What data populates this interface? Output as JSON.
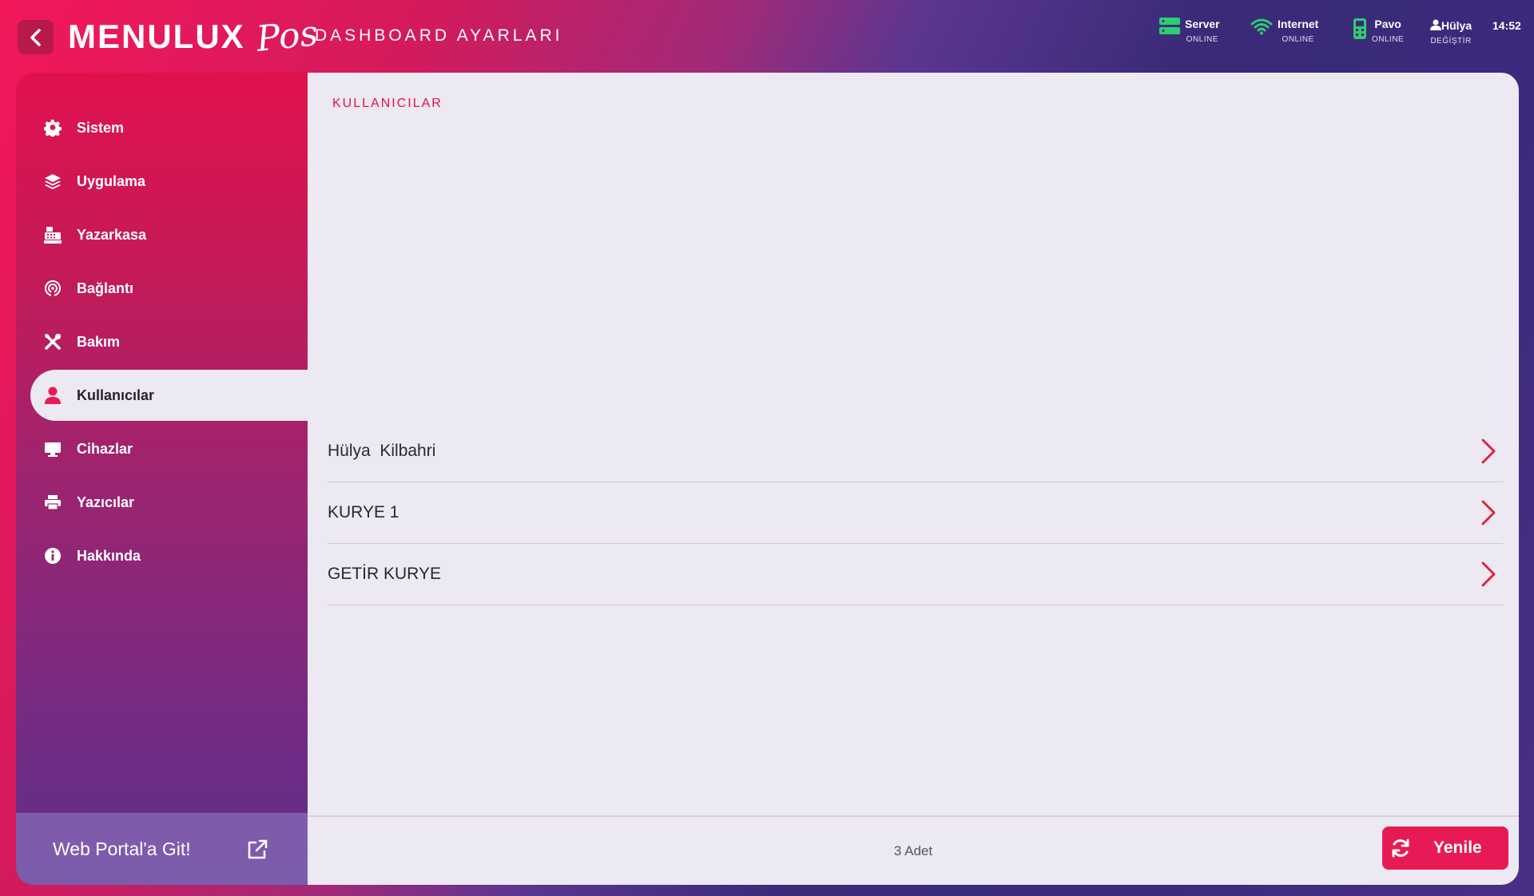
{
  "header": {
    "logo_text": "MENULUX",
    "logo_script": "Pos",
    "title": "DASHBOARD AYARLARI",
    "status": [
      {
        "name": "Server",
        "sub": "ONLINE",
        "icon": "server-icon"
      },
      {
        "name": "Internet",
        "sub": "ONLINE",
        "icon": "wifi-icon"
      },
      {
        "name": "Pavo",
        "sub": "ONLINE",
        "icon": "pos-terminal-icon"
      }
    ],
    "user": {
      "name": "Hülya",
      "sub": "DEĞİŞTİR",
      "icon": "user-icon"
    },
    "clock": "14:52",
    "status_color": "#2ecc71"
  },
  "sidebar": {
    "items": [
      {
        "label": "Sistem",
        "icon": "gear-icon"
      },
      {
        "label": "Uygulama",
        "icon": "layers-icon"
      },
      {
        "label": "Yazarkasa",
        "icon": "cash-register-icon"
      },
      {
        "label": "Bağlantı",
        "icon": "connection-icon"
      },
      {
        "label": "Bakım",
        "icon": "tools-icon"
      },
      {
        "label": "Kullanıcılar",
        "icon": "user-icon",
        "active": true
      },
      {
        "label": "Cihazlar",
        "icon": "monitor-icon"
      },
      {
        "label": "Yazıcılar",
        "icon": "printer-icon"
      },
      {
        "label": "Hakkında",
        "icon": "info-icon"
      }
    ],
    "web_portal_label": "Web Portal'a Git!"
  },
  "main": {
    "section_title": "KULLANICILAR",
    "users": [
      "Hülya  Kilbahri",
      "KURYE 1",
      "GETİR KURYE"
    ],
    "count_label": "3 Adet",
    "refresh_label": "Yenile"
  },
  "colors": {
    "accent": "#e81a55",
    "panel_bg": "#ece9f2"
  }
}
